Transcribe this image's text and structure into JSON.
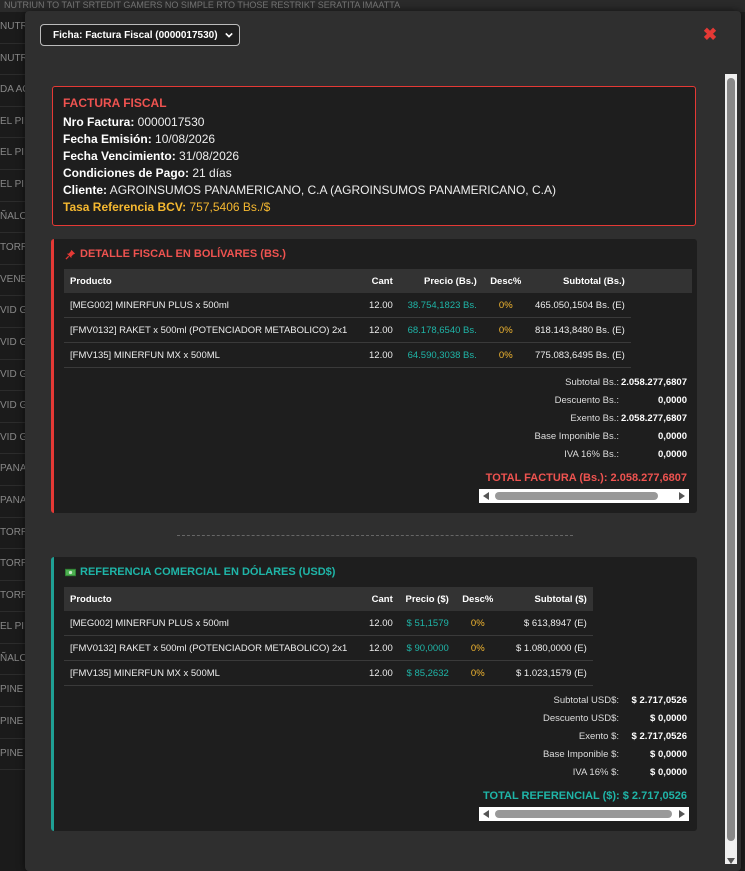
{
  "background": {
    "topbar_text": "NUTRIUN TO TAIT SRTEDIT GAMERS NO SIMPLE RTO THOSE RESTRIKT SERATITA IMAATTA",
    "left_rows": [
      "NUTR",
      "NUTR",
      "DA AG",
      "EL PIN",
      "EL PIN",
      "EL PIN",
      "ÑALOZ",
      "TORR",
      "VENE",
      "VID G",
      "VID G",
      "VID G",
      "VID G",
      "VID G",
      "PANA",
      "PANA",
      "TORR",
      "TORR",
      "TORR",
      "EL PIN",
      "ÑALOZ",
      "PINE",
      "PINE",
      "PINE"
    ]
  },
  "modal": {
    "selector_value": "Ficha: Factura Fiscal (0000017530)",
    "close_label": "✖"
  },
  "invoice": {
    "title": "FACTURA FISCAL",
    "lines": [
      {
        "label": "Nro Factura:",
        "value": " 0000017530"
      },
      {
        "label": "Fecha Emisión:",
        "value": " 10/08/2026"
      },
      {
        "label": "Fecha Vencimiento:",
        "value": " 31/08/2026"
      },
      {
        "label": "Condiciones de Pago:",
        "value": " 21 días"
      },
      {
        "label": "Cliente:",
        "value": " AGROINSUMOS PANAMERICANO, C.A (AGROINSUMOS PANAMERICANO, C.A)"
      }
    ],
    "rate_label": "Tasa Referencia BCV:",
    "rate_value": " 757,5406 Bs./$"
  },
  "bs_section": {
    "title": "DETALLE FISCAL EN BOLÍVARES (BS.)",
    "icon": "pushpin-icon",
    "headers": [
      "Producto",
      "Cant",
      "Precio (Bs.)",
      "Desc%",
      "Subtotal (Bs.)"
    ],
    "rows": [
      [
        "[MEG002] MINERFUN PLUS x 500ml",
        "12.00",
        "38.754,1823 Bs.",
        "0%",
        "465.050,1504 Bs. (E)"
      ],
      [
        "[FMV0132] RAKET x 500ml (POTENCIADOR METABOLICO) 2x1",
        "12.00",
        "68.178,6540 Bs.",
        "0%",
        "818.143,8480 Bs. (E)"
      ],
      [
        "[FMV135] MINERFUN MX x 500ML",
        "12.00",
        "64.590,3038 Bs.",
        "0%",
        "775.083,6495 Bs. (E)"
      ]
    ],
    "totals": [
      {
        "label": "Subtotal Bs.:",
        "value": "2.058.277,6807"
      },
      {
        "label": "Descuento Bs.:",
        "value": "0,0000"
      },
      {
        "label": "Exento Bs.:",
        "value": "2.058.277,6807"
      },
      {
        "label": "Base Imponible Bs.:",
        "value": "0,0000"
      },
      {
        "label": "IVA 16% Bs.:",
        "value": "0,0000"
      }
    ],
    "grand_total": "TOTAL FACTURA (Bs.): 2.058.277,6807"
  },
  "usd_section": {
    "title": "REFERENCIA COMERCIAL EN DÓLARES (USD$)",
    "icon": "money-icon",
    "headers": [
      "Producto",
      "Cant",
      "Precio ($)",
      "Desc%",
      "Subtotal ($)"
    ],
    "rows": [
      [
        "[MEG002] MINERFUN PLUS x 500ml",
        "12.00",
        "$ 51,1579",
        "0%",
        "$ 613,8947 (E)"
      ],
      [
        "[FMV0132] RAKET x 500ml (POTENCIADOR METABOLICO) 2x1",
        "12.00",
        "$ 90,0000",
        "0%",
        "$ 1.080,0000 (E)"
      ],
      [
        "[FMV135] MINERFUN MX x 500ML",
        "12.00",
        "$ 85,2632",
        "0%",
        "$ 1.023,1579 (E)"
      ]
    ],
    "totals": [
      {
        "label": "Subtotal USD$:",
        "value": "$ 2.717,0526"
      },
      {
        "label": "Descuento USD$:",
        "value": "$ 0,0000"
      },
      {
        "label": "Exento $:",
        "value": "$ 2.717,0526"
      },
      {
        "label": "Base Imponible $:",
        "value": "$ 0,0000"
      },
      {
        "label": "IVA 16% $:",
        "value": "$ 0,0000"
      }
    ],
    "grand_total": "TOTAL REFERENCIAL ($): $ 2.717,0526"
  },
  "colors": {
    "danger": "#e53935",
    "teal": "#1fa095",
    "warning": "#f5b830"
  }
}
